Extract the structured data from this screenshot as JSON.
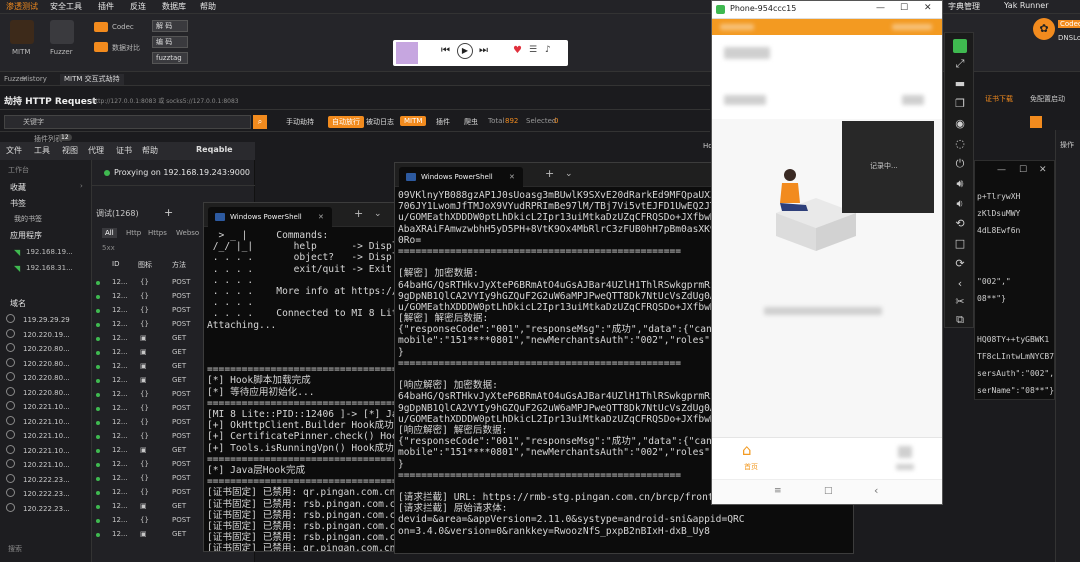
{
  "yakit": {
    "menu": [
      "渗透测试",
      "安全工具",
      "插件",
      "反连",
      "数据库",
      "帮助"
    ],
    "right_menu": [
      "字典管理",
      "Yak Runner"
    ],
    "right_badges": [
      "Codec",
      "DNSLo"
    ],
    "tools": [
      {
        "label": "MITM"
      },
      {
        "label": "Fuzzer"
      },
      {
        "label": "Codec"
      },
      {
        "label": "数据对比"
      }
    ],
    "selects": [
      "解 码",
      "编 码",
      "fuzztag"
    ],
    "tabs": [
      "Fuzzer",
      "History",
      "MITM 交互式劫持"
    ],
    "header_title": "劫持 HTTP Request",
    "header_addr": "http://127.0.0.1:8083  或 socks5://127.0.0.1:8083",
    "header_right": [
      "证书下载",
      "免配置启动"
    ],
    "search_placeholder": "关键字",
    "plugin_label": "插件列表",
    "plugin_count": "12",
    "filter_labels": [
      "手动劫持",
      "自动放行",
      "被动日志",
      "MITM",
      "插件",
      "爬虫"
    ],
    "total_label": "Total",
    "total": "892",
    "selected_label": "Selected",
    "selected": "0",
    "right_tab": "Ho",
    "right_op": "操作"
  },
  "reqable": {
    "menu": [
      "文件",
      "工具",
      "视图",
      "代理",
      "证书",
      "帮助"
    ],
    "app_name": "Reqable",
    "proxy_text": "Proxying on 192.168.19.243:9000",
    "sidebar": {
      "workbench": "工作台",
      "favorites": "收藏",
      "bookmarks": "书签",
      "my_bookmarks": "我的书签",
      "apps": "应用程序",
      "ips": [
        "192.168.19...",
        "192.168.31..."
      ],
      "domains_header": "域名",
      "domains": [
        "119.29.29.29",
        "120.220.19...",
        "120.220.80...",
        "120.220.80...",
        "120.220.80...",
        "120.220.80...",
        "120.221.10...",
        "120.221.10...",
        "120.221.10...",
        "120.221.10...",
        "120.221.10...",
        "120.222.23...",
        "120.222.23...",
        "120.222.23..."
      ],
      "search": "搜索"
    },
    "debug_tab": "调试(1268)",
    "filters": [
      "All",
      "Http",
      "Https",
      "Webso"
    ],
    "list_sub": "5xx",
    "columns": [
      "ID",
      "图标",
      "方法"
    ],
    "rows": [
      {
        "id": "12...",
        "icon": "{}",
        "method": "POST"
      },
      {
        "id": "12...",
        "icon": "{}",
        "method": "POST"
      },
      {
        "id": "12...",
        "icon": "{}",
        "method": "POST"
      },
      {
        "id": "12...",
        "icon": "{}",
        "method": "POST"
      },
      {
        "id": "12...",
        "icon": "img",
        "method": "GET"
      },
      {
        "id": "12...",
        "icon": "img",
        "method": "GET"
      },
      {
        "id": "12...",
        "icon": "img",
        "method": "GET"
      },
      {
        "id": "12...",
        "icon": "img",
        "method": "GET"
      },
      {
        "id": "12...",
        "icon": "{}",
        "method": "POST"
      },
      {
        "id": "12...",
        "icon": "{}",
        "method": "POST"
      },
      {
        "id": "12...",
        "icon": "{}",
        "method": "POST"
      },
      {
        "id": "12...",
        "icon": "{}",
        "method": "POST"
      },
      {
        "id": "12...",
        "icon": "img",
        "method": "GET"
      },
      {
        "id": "12...",
        "icon": "{}",
        "method": "POST"
      },
      {
        "id": "12...",
        "icon": "{}",
        "method": "POST"
      },
      {
        "id": "12...",
        "icon": "{}",
        "method": "POST"
      },
      {
        "id": "12...",
        "icon": "img",
        "method": "GET"
      },
      {
        "id": "12...",
        "icon": "{}",
        "method": "POST"
      },
      {
        "id": "12...",
        "icon": "img",
        "method": "GET"
      }
    ]
  },
  "ps1": {
    "title": "Windows PowerShell",
    "lines": [
      "  > _ |     Commands:",
      " /_/ |_|       help      -> Displ",
      " . . . .       object?   -> Displ",
      " . . . .       exit/quit -> Exit",
      " . . . .",
      " . . . .    More info at https://f",
      " . . . .",
      " . . . .    Connected to MI 8 Lite",
      "Attaching...",
      "",
      "",
      "",
      "=================================",
      "[*] Hook脚本加载完成",
      "[*] 等待应用初始化...",
      "=================================",
      "[MI 8 Lite::PID::12406 ]-> [*] Java",
      "[+] OkHttpClient.Builder Hook成功",
      "[+] CertificatePinner.check() Hook成",
      "[+] Tools.isRunningVpn() Hook成功",
      "=================================",
      "[*] Java层Hook完成",
      "=================================",
      "[证书固定] 已禁用: qr.pingan.com.cn",
      "[证书固定] 已禁用: rsb.pingan.com.cn",
      "[证书固定] 已禁用: rsb.pingan.com.cn",
      "[证书固定] 已禁用: rsb.pingan.com.cn",
      "[证书固定] 已禁用: rsb.pingan.com.cn",
      "[证书固定] 已禁用: qr.pingan.com.cn"
    ]
  },
  "ps2": {
    "title": "Windows PowerShell",
    "lines": [
      "09VKlnyYB088gzAP1J0sUoasg3mBUwlK9SXvE20dRarkEd9MFQpaUX3h+hvr",
      "706JY1LwomJfTMJoX9VYudRPRImBe97lM/TBj7Vi5vtEJFD1UwEQ2JT3Igh8",
      "u/GOMEathXDDDW0ptLhDkicL2Ipr13uiMtkaDzUZqCFRQSDo+JXfbwD3AZ9I",
      "AbaXRAiFAmwzwbhH5yD5PH+8VtK9Ox4MbRlrC3zFUB0hH7pBm0asXK9DD3ad",
      "0Ro=",
      "=================================================",
      "",
      "[解密] 加密数据:",
      "64baHG/QsRTHkvJyXteP6BRmAtO4uGsAJBar4UZlH1ThlRSwkgprmRzAhkl5",
      "9gDpNB1QlCA2VYIy9hGZQuF2G2uW6aMPJPweQTT8Dk7NtUcVsZdUg0AhgJM",
      "u/GOMEathXDDDW0ptLhDkicL2Ipr13uiMtkaDzUZqCFRQSDo+JXfbwD3AZ9I",
      "[解密] 解密后数据:",
      "{\"responseCode\":\"001\",\"responseMsg\":\"成功\",\"data\":{\"canD",
      "mobile\":\"151****0801\",\"newMerchantsAuth\":\"002\",\"roles\":[],\"u",
      "}",
      "=================================================",
      "",
      "[响应解密] 加密数据:",
      "64baHG/QsRTHkvJyXteP6BRmAtO4uGsAJBar4UZlH1ThlRSwkgprmRzAhkl5",
      "9gDpNB1QlCA2VYIy9hGZQuF2G2uW6aMPJPweQTT8Dk7NtUcVsZdUg0AhgJM",
      "u/GOMEathXDDDW0ptLhDkicL2Ipr13uiMtkaDzUZqCFRQSDo+JXfbwD3AZ9I",
      "[响应解密] 解密后数据:",
      "{\"responseCode\":\"001\",\"responseMsg\":\"成功\",\"data\":{\"canDeale",
      "mobile\":\"151****0801\",\"newMerchantsAuth\":\"002\",\"roles\":[],\"u",
      "}",
      "=================================================",
      "",
      "[请求拦截] URL: https://rmb-stg.pingan.com.cn/brcp/front/all",
      "[请求拦截] 原始请求体:",
      "devid=&area=&appVersion=2.11.0&systype=android-sni&appid=QRC",
      "on=3.4.0&version=0&rankkey=RwoozNfS_pxpB2nBIxH-dxB_Uy8"
    ],
    "right_overflow": [
      "p+TlrywXH",
      "zKlDsuMWY",
      "4dL8Ewf6n",
      "\"002\",\"",
      "08**\"}",
      "HQ08TY++tyGBWK1",
      "TF8cLIntwLmNYCB7",
      "sersAuth\":\"002\",\"",
      "serName\":\"08**\"}",
      "B38D1&aldVersi"
    ]
  },
  "ps1_right": [
    "p+TlrywXH",
    "+tyGBWK1",
    "wLmNYCB7"
  ],
  "phone": {
    "title": "Phone-954ccc15",
    "recording_text": "记录中...",
    "tab_home": "首页",
    "nav": [
      "≡",
      "□",
      "‹"
    ]
  },
  "colors": {
    "accent_orange": "#f39a21",
    "yakit_orange": "#f28b1e",
    "proxy_green": "#3fb950",
    "ps_bg": "#0c0c0c"
  }
}
